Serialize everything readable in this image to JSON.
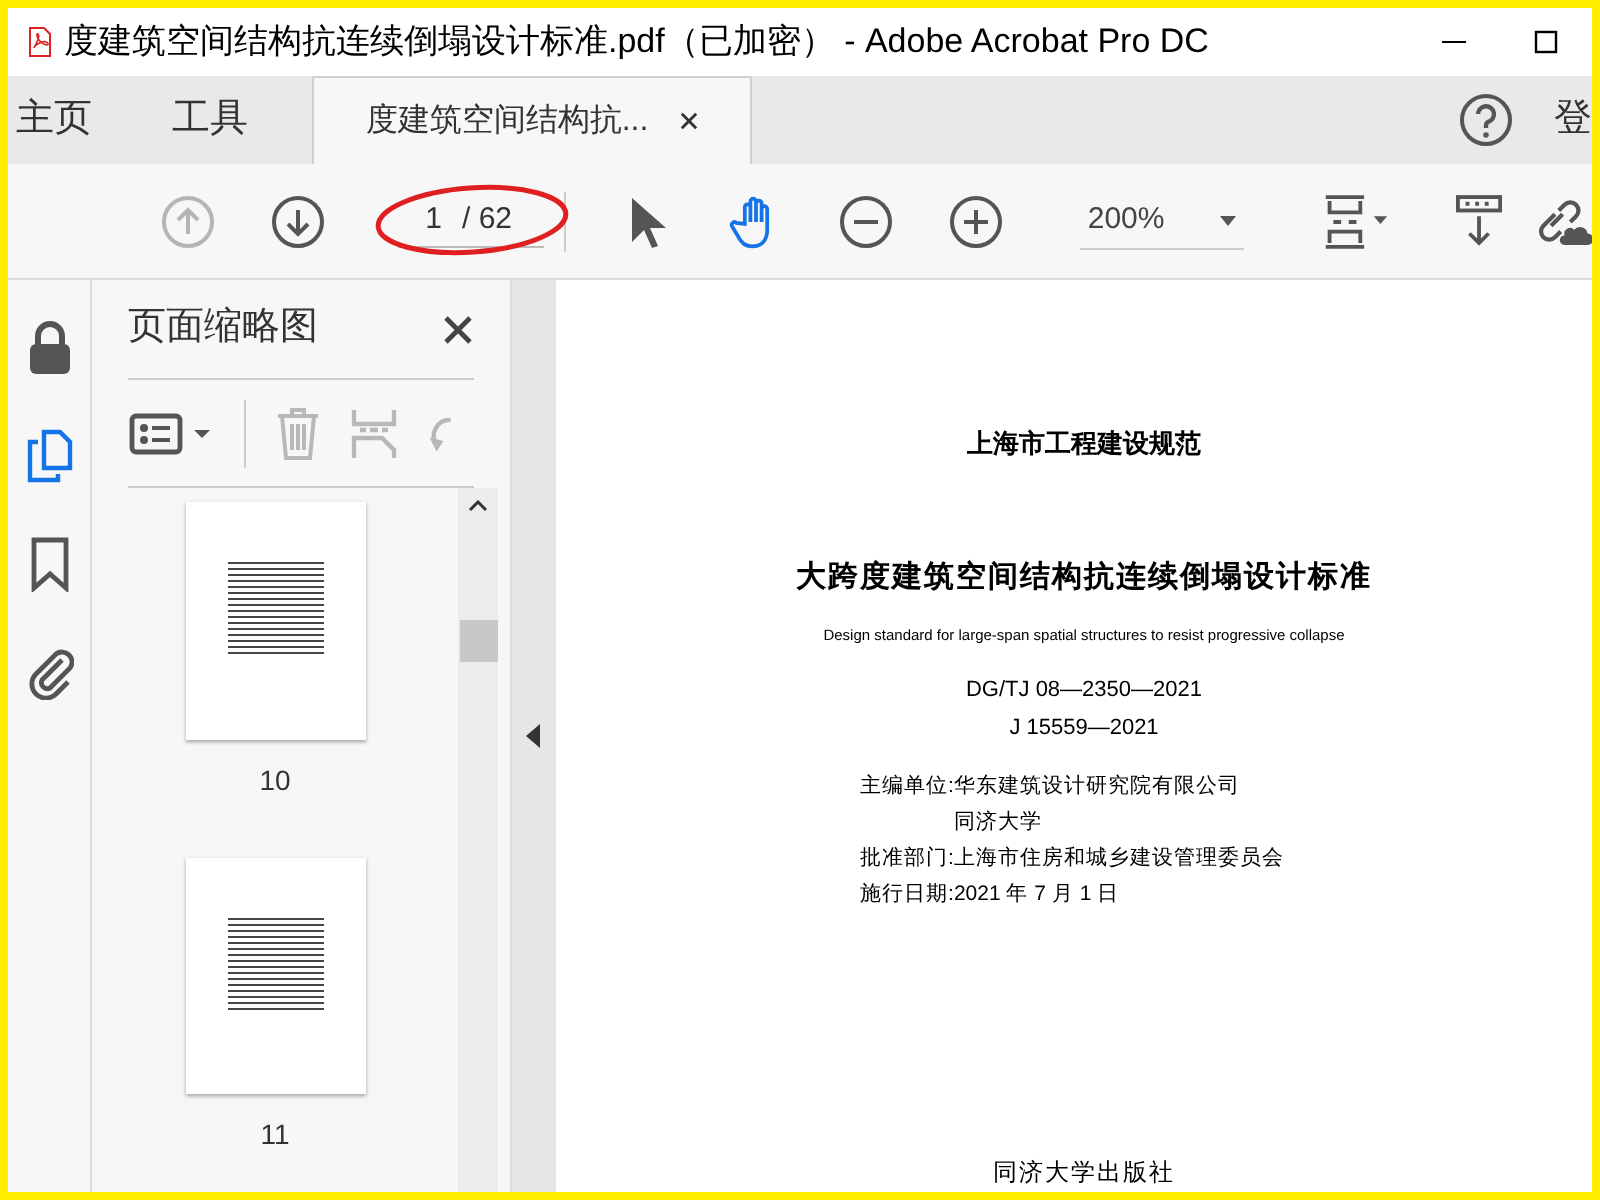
{
  "window": {
    "title": "度建筑空间结构抗连续倒塌设计标准.pdf（已加密） - Adobe Acrobat Pro DC"
  },
  "tabs": [
    {
      "label": "主页",
      "kind": "nav",
      "selected": false
    },
    {
      "label": "工具",
      "kind": "nav",
      "selected": false
    },
    {
      "label": "度建筑空间结构抗...",
      "kind": "document",
      "selected": true
    }
  ],
  "account_label": "登",
  "toolbar": {
    "tools": [
      {
        "kind": "prev",
        "disabled": true
      },
      {
        "kind": "next",
        "disabled": false
      }
    ],
    "page_field": {
      "value": "1",
      "total": "/ 62"
    },
    "modes": [
      {
        "kind": "select",
        "selected": false
      },
      {
        "kind": "hand",
        "selected": true
      },
      {
        "kind": "zoom_out",
        "selected": false
      },
      {
        "kind": "zoom_in",
        "selected": false
      }
    ],
    "zoom": {
      "value": "200%"
    }
  },
  "side_rail": [
    {
      "kind": "lock",
      "selected": false
    },
    {
      "kind": "pages",
      "selected": true
    },
    {
      "kind": "bookmark",
      "selected": false
    },
    {
      "kind": "attachment",
      "selected": false
    }
  ],
  "thumbnail_panel": {
    "title": "页面缩略图",
    "actions": [
      {
        "kind": "trash",
        "disabled": true
      },
      {
        "kind": "insert",
        "disabled": true
      },
      {
        "kind": "rotate",
        "disabled": true
      }
    ],
    "thumbnails": [
      {
        "label": "10"
      },
      {
        "label": "11"
      }
    ]
  },
  "document": {
    "series": "上海市工程建设规范",
    "title": "大跨度建筑空间结构抗连续倒塌设计标准",
    "english_title": "Design standard for large-span spatial structures to resist progressive collapse",
    "codes": [
      "DG/TJ 08—2350—2021",
      "J 15559—2021"
    ],
    "details": [
      {
        "label": "主编单位:",
        "value": "华东建筑设计研究院有限公司"
      },
      {
        "value": "同济大学"
      },
      {
        "label": "批准部门:",
        "value": "上海市住房和城乡建设管理委员会"
      },
      {
        "label": "施行日期:",
        "value": "2021 年 7 月 1 日"
      }
    ],
    "publisher": "同济大学出版社"
  }
}
